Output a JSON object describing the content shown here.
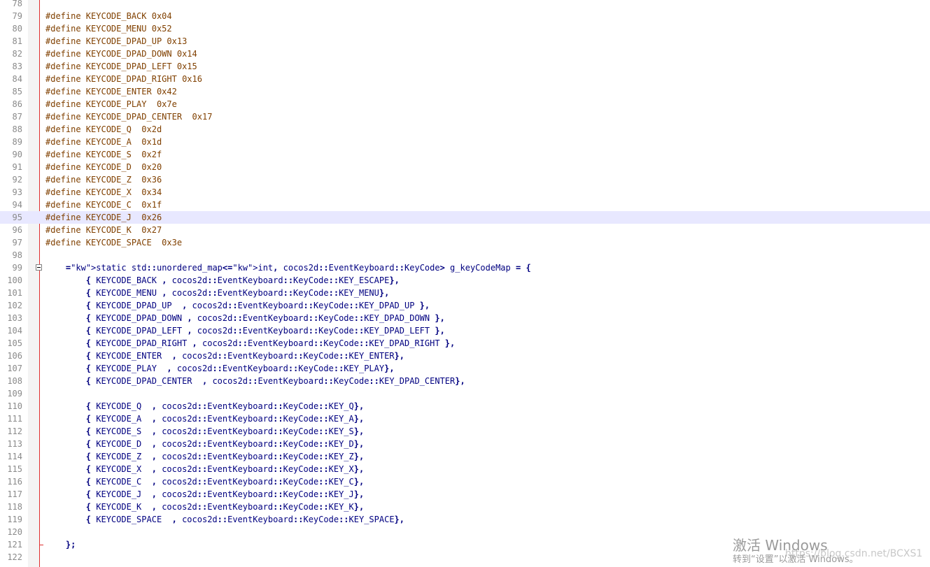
{
  "editor": {
    "first_line": 78,
    "current_line": 95,
    "fold_open_line": 99,
    "fold_close_line": 121,
    "lines": [
      "",
      "#define KEYCODE_BACK 0x04",
      "#define KEYCODE_MENU 0x52",
      "#define KEYCODE_DPAD_UP 0x13",
      "#define KEYCODE_DPAD_DOWN 0x14",
      "#define KEYCODE_DPAD_LEFT 0x15",
      "#define KEYCODE_DPAD_RIGHT 0x16",
      "#define KEYCODE_ENTER 0x42",
      "#define KEYCODE_PLAY  0x7e",
      "#define KEYCODE_DPAD_CENTER  0x17",
      "#define KEYCODE_Q  0x2d",
      "#define KEYCODE_A  0x1d",
      "#define KEYCODE_S  0x2f",
      "#define KEYCODE_D  0x20",
      "#define KEYCODE_Z  0x36",
      "#define KEYCODE_X  0x34",
      "#define KEYCODE_C  0x1f",
      "#define KEYCODE_J  0x26",
      "#define KEYCODE_K  0x27",
      "#define KEYCODE_SPACE  0x3e",
      "",
      "    static std::unordered_map<int, cocos2d::EventKeyboard::KeyCode> g_keyCodeMap = {",
      "        { KEYCODE_BACK , cocos2d::EventKeyboard::KeyCode::KEY_ESCAPE},",
      "        { KEYCODE_MENU , cocos2d::EventKeyboard::KeyCode::KEY_MENU},",
      "        { KEYCODE_DPAD_UP  , cocos2d::EventKeyboard::KeyCode::KEY_DPAD_UP },",
      "        { KEYCODE_DPAD_DOWN , cocos2d::EventKeyboard::KeyCode::KEY_DPAD_DOWN },",
      "        { KEYCODE_DPAD_LEFT , cocos2d::EventKeyboard::KeyCode::KEY_DPAD_LEFT },",
      "        { KEYCODE_DPAD_RIGHT , cocos2d::EventKeyboard::KeyCode::KEY_DPAD_RIGHT },",
      "        { KEYCODE_ENTER  , cocos2d::EventKeyboard::KeyCode::KEY_ENTER},",
      "        { KEYCODE_PLAY  , cocos2d::EventKeyboard::KeyCode::KEY_PLAY},",
      "        { KEYCODE_DPAD_CENTER  , cocos2d::EventKeyboard::KeyCode::KEY_DPAD_CENTER},",
      "",
      "        { KEYCODE_Q  , cocos2d::EventKeyboard::KeyCode::KEY_Q},",
      "        { KEYCODE_A  , cocos2d::EventKeyboard::KeyCode::KEY_A},",
      "        { KEYCODE_S  , cocos2d::EventKeyboard::KeyCode::KEY_S},",
      "        { KEYCODE_D  , cocos2d::EventKeyboard::KeyCode::KEY_D},",
      "        { KEYCODE_Z  , cocos2d::EventKeyboard::KeyCode::KEY_Z},",
      "        { KEYCODE_X  , cocos2d::EventKeyboard::KeyCode::KEY_X},",
      "        { KEYCODE_C  , cocos2d::EventKeyboard::KeyCode::KEY_C},",
      "        { KEYCODE_J  , cocos2d::EventKeyboard::KeyCode::KEY_J},",
      "        { KEYCODE_K  , cocos2d::EventKeyboard::KeyCode::KEY_K},",
      "        { KEYCODE_SPACE  , cocos2d::EventKeyboard::KeyCode::KEY_SPACE},",
      "",
      "    };",
      ""
    ]
  },
  "colors": {
    "preprocessor": "#804000",
    "keyword": "#0000ff",
    "identifier": "#000080",
    "line_number": "#8a8a8a",
    "current_line_bg": "#e8e8ff",
    "fold_line": "#e03030"
  },
  "watermark": {
    "activate_title": "激活 Windows",
    "activate_hint": "转到“设置”以激活 Windows。",
    "blog_url": "https://blog.csdn.net/BCXS1"
  }
}
